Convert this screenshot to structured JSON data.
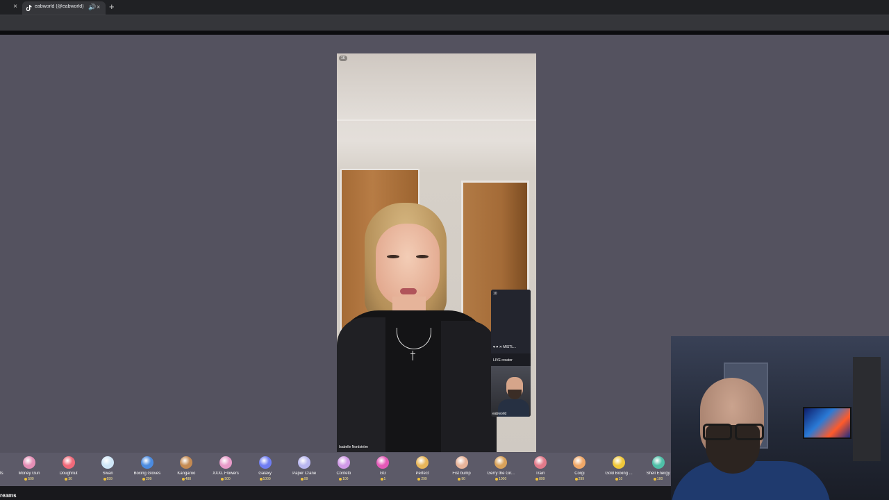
{
  "browser": {
    "tab_title": "eabworld (@eabworld) is LIVE",
    "new_tab_symbol": "+",
    "close_symbol": "×",
    "audio_symbol": "🔊"
  },
  "live": {
    "viewer_count": "16",
    "streamer_name": "Isabelle Nordström"
  },
  "guest": {
    "count": "10",
    "icons_text": "♥ ♥ ✕ MISTL...",
    "label": "LIVE creator",
    "username": "eabworld"
  },
  "gifts": {
    "partial_left": "ts",
    "items": [
      {
        "name": "Money Gun",
        "price": "500",
        "icon": "money-gun-icon",
        "color": "#e58fb6"
      },
      {
        "name": "Doughnut",
        "price": "30",
        "icon": "doughnut-icon",
        "color": "#f06a7a"
      },
      {
        "name": "Swan",
        "price": "699",
        "icon": "swan-icon",
        "color": "#cfe6f7"
      },
      {
        "name": "Boxing Gloves",
        "price": "299",
        "icon": "boxing-gloves-icon",
        "color": "#4b8be0"
      },
      {
        "name": "Kangaroo",
        "price": "488",
        "icon": "kangaroo-icon",
        "color": "#c48a52"
      },
      {
        "name": "XXXL Flowers",
        "price": "500",
        "icon": "flowers-icon",
        "color": "#e79ac8"
      },
      {
        "name": "Galaxy",
        "price": "1000",
        "icon": "galaxy-icon",
        "color": "#6f7df2"
      },
      {
        "name": "Paper Crane",
        "price": "99",
        "icon": "paper-crane-icon",
        "color": "#b9b7f0"
      },
      {
        "name": "Confetti",
        "price": "100",
        "icon": "confetti-icon",
        "color": "#d19ae8"
      },
      {
        "name": "GG",
        "price": "1",
        "icon": "gg-icon",
        "color": "#e45ab8"
      },
      {
        "name": "Perfect",
        "price": "299",
        "icon": "perfect-icon",
        "color": "#e8b65a"
      },
      {
        "name": "Fist bump",
        "price": "90",
        "icon": "fist-bump-icon",
        "color": "#e8b49a"
      },
      {
        "name": "Gerry the Gir...",
        "price": "1000",
        "icon": "giraffe-icon",
        "color": "#d9a25a"
      },
      {
        "name": "Train",
        "price": "899",
        "icon": "train-icon",
        "color": "#e27a8a"
      },
      {
        "name": "Corgi",
        "price": "299",
        "icon": "corgi-icon",
        "color": "#f0a868"
      },
      {
        "name": "Gold Boxing ...",
        "price": "10",
        "icon": "gold-boxing-icon",
        "color": "#f0c83a"
      },
      {
        "name": "Shell Energy",
        "price": "100",
        "icon": "shell-energy-icon",
        "color": "#4ec0a8"
      }
    ]
  },
  "bottom": {
    "text": "reams"
  }
}
